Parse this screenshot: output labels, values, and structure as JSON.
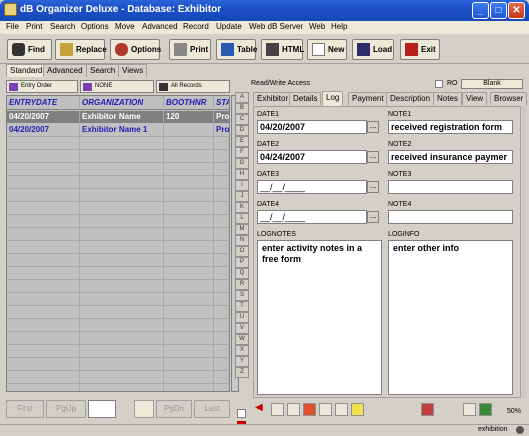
{
  "window": {
    "title": "dB Organizer Deluxe - Database: Exhibitor",
    "min": "_",
    "max": "□",
    "close": "✕"
  },
  "menu": [
    "File",
    "Print",
    "Search",
    "Options",
    "Move",
    "Advanced",
    "Record",
    "Update",
    "Web dB Server",
    "Web",
    "Help"
  ],
  "toolbar": {
    "find": "Find",
    "replace": "Replace",
    "options": "Options",
    "print": "Print",
    "table": "Table",
    "html": "HTML",
    "new": "New",
    "load": "Load",
    "exit": "Exit"
  },
  "left_tabs": [
    "Standard",
    "Advanced",
    "Search",
    "Views"
  ],
  "sort": {
    "entry_order": "Entry Order",
    "none": "NONE",
    "all_records": "All Records"
  },
  "grid": {
    "columns": [
      "ENTRYDATE",
      "ORGANIZATION",
      "BOOTHNR",
      "STA"
    ],
    "rows": [
      [
        "04/20/2007",
        "Exhibitor Name",
        "120",
        "Pro"
      ],
      [
        "04/20/2007",
        "Exhibitor Name 1",
        "",
        "Pro"
      ]
    ]
  },
  "nav": {
    "first": "First",
    "pgup": "PgUp",
    "pgdn": "PgDn",
    "last": "Last"
  },
  "alphabet": [
    "A",
    "B",
    "C",
    "D",
    "E",
    "F",
    "G",
    "H",
    "I",
    "J",
    "K",
    "L",
    "M",
    "N",
    "O",
    "P",
    "Q",
    "R",
    "S",
    "T",
    "U",
    "V",
    "W",
    "X",
    "Y",
    "Z"
  ],
  "access": {
    "mode": "Read/Write Access",
    "ro_label": "RO",
    "blank_label": "Blank"
  },
  "right_tabs": [
    "Exhibitor",
    "Details",
    "Log",
    "Payment",
    "Description",
    "Notes",
    "View",
    "Browser"
  ],
  "active_tab": "Log",
  "log": {
    "date1_label": "DATE1",
    "date1": "04/20/2007",
    "note1_label": "NOTE1",
    "note1": "received registration form",
    "date2_label": "DATE2",
    "date2": "04/24/2007",
    "note2_label": "NOTE2",
    "note2": "received insurance paymer",
    "date3_label": "DATE3",
    "date3": "__/__/____",
    "note3_label": "NOTE3",
    "note3": "",
    "date4_label": "DATE4",
    "date4": "__/__/____",
    "note4_label": "NOTE4",
    "note4": "",
    "lognotes_label": "LOGNOTES",
    "lognotes": "enter activity notes in a free form",
    "loginfo_label": "LOGINFO",
    "loginfo": "enter other info",
    "ellipsis": "..."
  },
  "zoom": "50%",
  "status": {
    "db_name": "exhibition"
  },
  "colors": {
    "selected_row": "#808080",
    "header_text": "#1d1db4",
    "row_text": "#1d1db4"
  }
}
